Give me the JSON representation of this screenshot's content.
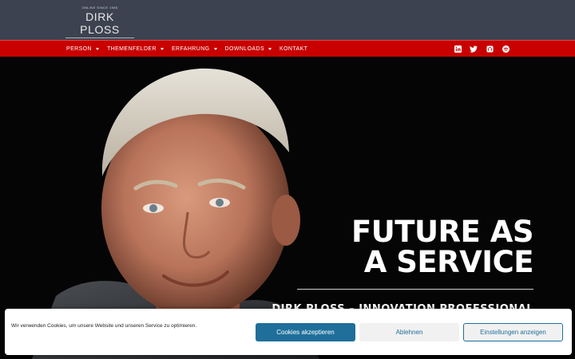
{
  "logo": {
    "tag_top": "ONLINE SINCE 1985",
    "name": "DIRK PLOSS",
    "tag_bottom": "INNOVATION PROFESSIONAL"
  },
  "nav": {
    "items": [
      {
        "label": "PERSON",
        "dropdown": true
      },
      {
        "label": "THEMENFELDER",
        "dropdown": true
      },
      {
        "label": "ERFAHRUNG",
        "dropdown": true
      },
      {
        "label": "DOWNLOADS",
        "dropdown": true
      },
      {
        "label": "KONTAKT",
        "dropdown": false
      }
    ],
    "social_icons": [
      "linkedin-icon",
      "twitter-icon",
      "podcast-icon",
      "spotify-icon"
    ]
  },
  "hero": {
    "title_line1": "FUTURE AS",
    "title_line2": "A SERVICE",
    "subtitle": "DIRK PLOSS – INNOVATION PROFESSIONAL"
  },
  "cookie": {
    "text": "Wir verwenden Cookies, um unsere Website und unseren Service zu optimieren.",
    "accept_label": "Cookies akzeptieren",
    "deny_label": "Ablehnen",
    "settings_label": "Einstellungen anzeigen"
  },
  "colors": {
    "header_bg": "#3d4250",
    "nav_bg": "#c80000",
    "button_primary": "#1f6f9a"
  }
}
